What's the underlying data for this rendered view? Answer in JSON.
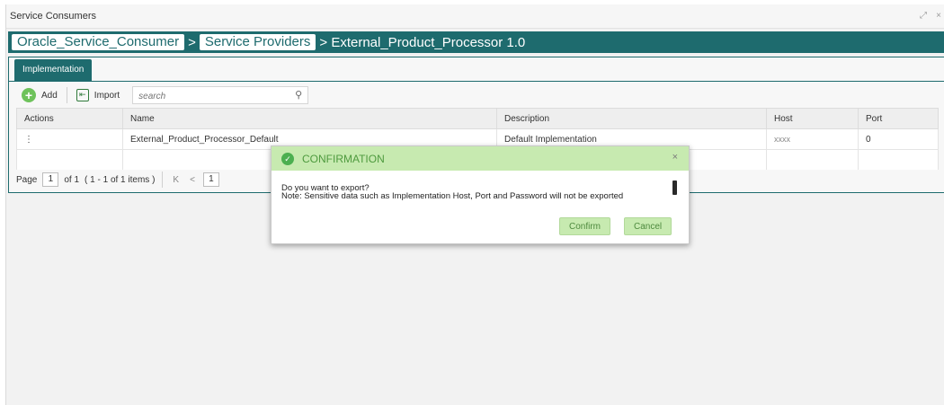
{
  "window": {
    "title": "Service Consumers",
    "controls": [
      "⤢",
      "×"
    ]
  },
  "breadcrumb": {
    "items": [
      "Oracle_Service_Consumer",
      "Service Providers"
    ],
    "separator": ">",
    "current": "> External_Product_Processor 1.0"
  },
  "tabs": [
    {
      "label": "Implementation"
    }
  ],
  "toolbar": {
    "add_label": "Add",
    "import_label": "Import",
    "search_placeholder": "search"
  },
  "table": {
    "headers": [
      "Actions",
      "Name",
      "Description",
      "Host",
      "Port"
    ],
    "rows": [
      {
        "actions": "⋮",
        "name": "External_Product_Processor_Default",
        "description": "Default Implementation",
        "host": "xxxx",
        "port": "0"
      }
    ]
  },
  "pager": {
    "page_label": "Page",
    "page": "1",
    "of_label": "of 1",
    "items_label": "( 1 - 1 of 1 items )",
    "first": "K",
    "prev": "<",
    "current": "1"
  },
  "modal": {
    "title": "CONFIRMATION",
    "close": "×",
    "line1": "Do you want to export?",
    "line2": "Note: Sensitive data such as Implementation Host, Port and Password will not be exported",
    "confirm_label": "Confirm",
    "cancel_label": "Cancel"
  },
  "colors": {
    "brand": "#1e6b6e",
    "confirm_header": "#c7eab0",
    "success": "#4caf50"
  }
}
